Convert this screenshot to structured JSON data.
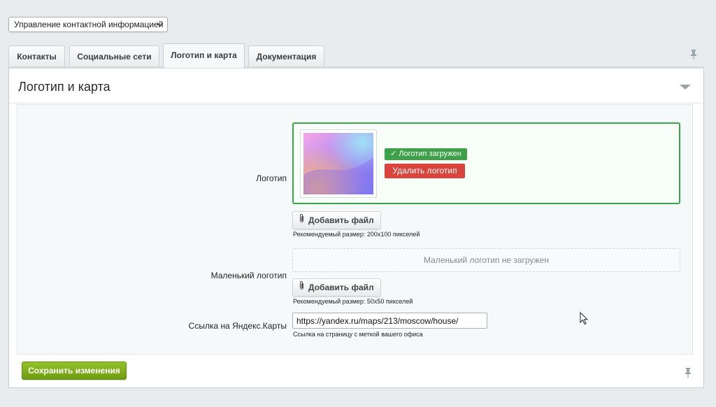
{
  "topselect": {
    "value": "Управление контактной информацией",
    "icon": "chevron-down-icon"
  },
  "tabs": [
    {
      "label": "Контакты"
    },
    {
      "label": "Социальные сети"
    },
    {
      "label": "Логотип и карта",
      "active": true
    },
    {
      "label": "Документация"
    }
  ],
  "panel": {
    "title": "Логотип и карта"
  },
  "logo": {
    "label": "Логотип",
    "status": "✓ Логотип загружен",
    "delete_label": "Удалить логотип",
    "add_label": "Добавить файл",
    "hint": "Рекомендуемый размер: 200x100 пикселей",
    "status_color": "#3ea048",
    "delete_color": "#d9443d"
  },
  "small_logo": {
    "label": "Маленький логотип",
    "empty_text": "Маленький логотип не загружен",
    "add_label": "Добавить файл",
    "hint": "Рекомендуемый размер: 50x50 пикселей"
  },
  "map_link": {
    "label": "Ссылка на Яндекс.Карты",
    "value": "https://yandex.ru/maps/213/moscow/house/",
    "hint": "Ссылка на страницу с меткой вашего офиса"
  },
  "footer": {
    "save_label": "Сохранить изменения",
    "save_color": "#7fae1b"
  }
}
